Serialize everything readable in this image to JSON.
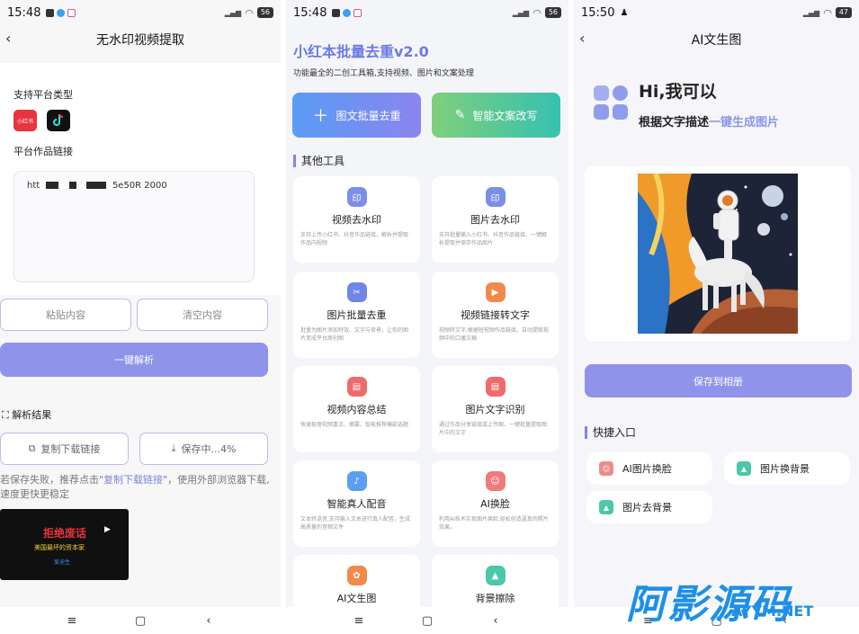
{
  "colors": {
    "accent": "#8f93ea",
    "title_blue": "#6b7ae6",
    "watermark": "#1e8fe6"
  },
  "screen1": {
    "status": {
      "time": "15:48",
      "battery": "56"
    },
    "title": "无水印视频提取",
    "platform_label": "支持平台类型",
    "platforms": [
      "小红书",
      "抖音"
    ],
    "link_label": "平台作品链接",
    "link_start": "htt",
    "link_end": "5e50R 2000",
    "paste": "粘贴内容",
    "clear": "清空内容",
    "parse": "一键解析",
    "result_label": "解析结果",
    "copy_link": "复制下载链接",
    "saving": "保存中...4%",
    "hint_a": "若保存失败，推荐点击\"",
    "hint_link": "复制下载链接",
    "hint_b": "\"，使用外部浏览器下载,速度更快更稳定",
    "video": {
      "title": "拒绝废话",
      "subtitle": "美国最坏的资本家",
      "author": "爱迪生"
    }
  },
  "screen2": {
    "status": {
      "time": "15:48",
      "battery": "56"
    },
    "app_title": "小红本批量去重v2.0",
    "app_sub": "功能最全的二创工具箱,支持视频、图片和文案处理",
    "btn_batch": "图文批量去重",
    "btn_rewrite": "智能文案改写",
    "section": "其他工具",
    "tools": [
      {
        "title": "视频去水印",
        "desc": "支持上传小红书、抖音作品链接，解析并提取作品内视频",
        "icon": "video-watermark-icon",
        "color": "#7b8fe8"
      },
      {
        "title": "图片去水印",
        "desc": "支持批量输入小红书、抖音作品链接，一键解析提取并保存作品图片",
        "icon": "image-watermark-icon",
        "color": "#7b8fe8"
      },
      {
        "title": "图片批量去重",
        "desc": "批量为图片添加特效、文字与背景，让你的图片变成平台原创图",
        "icon": "image-dedupe-icon",
        "color": "#6f86e8"
      },
      {
        "title": "视频链接转文字",
        "desc": "视频转文字,根据短视频作品链接，自动提取视频中的口播文稿",
        "icon": "video-text-icon",
        "color": "#f08a4b"
      },
      {
        "title": "视频内容总结",
        "desc": "快速梳理视频重点、摘要、智能推荐爆款选题",
        "icon": "summary-icon",
        "color": "#ef6b6b"
      },
      {
        "title": "图片文字识别",
        "desc": "通过作品分享链接或上传图，一键批量提取图片中的文字",
        "icon": "ocr-icon",
        "color": "#ef6b6b"
      },
      {
        "title": "智能真人配音",
        "desc": "文本转语音,支持输入文本进行真人配音，生成高质量的音频文件",
        "icon": "voice-icon",
        "color": "#5c9ef0"
      },
      {
        "title": "AI换脸",
        "desc": "利用AI技术实现图片换脸,轻松创造逼真的照片效果。",
        "icon": "face-swap-icon",
        "color": "#ef7b7b"
      },
      {
        "title": "AI文生图",
        "desc": "",
        "icon": "ai-image-icon",
        "color": "#f08a4b"
      },
      {
        "title": "背景擦除",
        "desc": "",
        "icon": "bg-erase-icon",
        "color": "#4cc7a8"
      }
    ]
  },
  "screen3": {
    "status": {
      "time": "15:50",
      "battery": "47"
    },
    "title": "AI文生图",
    "hi": "Hi,我可以",
    "desc_a": "根据文字描述",
    "desc_hl": "一键生成图片",
    "save": "保存到相册",
    "section": "快捷入口",
    "quick": [
      {
        "label": "AI图片换脸",
        "icon": "face-swap-icon",
        "color": "#ef8a8a"
      },
      {
        "label": "图片换背景",
        "icon": "change-bg-icon",
        "color": "#4cc7a8"
      },
      {
        "label": "图片去背景",
        "icon": "remove-bg-icon",
        "color": "#4cc7a8"
      }
    ],
    "watermark": "阿影源码",
    "watermark_url": "AYYM.NET"
  }
}
